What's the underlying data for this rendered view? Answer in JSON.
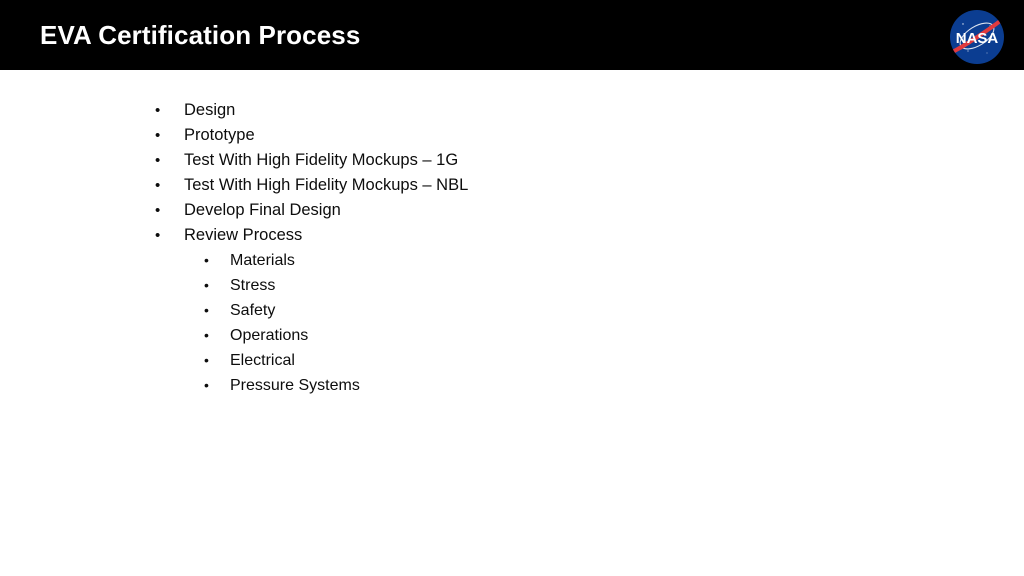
{
  "slide": {
    "header": {
      "title": "EVA Certification Process",
      "background_color": "#000000",
      "title_color": "#ffffff",
      "logo": {
        "icon_name": "nasa-meatball-logo",
        "wordmark": "NASA",
        "circle_color": "#0b3d91",
        "swoosh_color": "#e03a3e",
        "text_color": "#ffffff"
      }
    },
    "body": {
      "background_color": "#ffffff",
      "text_color": "#0d0d0d",
      "bullet_glyph": "•",
      "items": [
        {
          "level": 1,
          "bullet": "•",
          "label": "Design"
        },
        {
          "level": 1,
          "bullet": "•",
          "label": "Prototype"
        },
        {
          "level": 1,
          "bullet": "•",
          "label": "Test With High Fidelity Mockups – 1G"
        },
        {
          "level": 1,
          "bullet": "•",
          "label": "Test With High Fidelity Mockups – NBL"
        },
        {
          "level": 1,
          "bullet": "•",
          "label": "Develop Final Design"
        },
        {
          "level": 1,
          "bullet": "•",
          "label": "Review Process"
        },
        {
          "level": 2,
          "bullet": "•",
          "label": "Materials"
        },
        {
          "level": 2,
          "bullet": "•",
          "label": "Stress"
        },
        {
          "level": 2,
          "bullet": "•",
          "label": "Safety"
        },
        {
          "level": 2,
          "bullet": "•",
          "label": "Operations"
        },
        {
          "level": 2,
          "bullet": "•",
          "label": "Electrical"
        },
        {
          "level": 2,
          "bullet": "•",
          "label": "Pressure Systems"
        }
      ]
    }
  }
}
